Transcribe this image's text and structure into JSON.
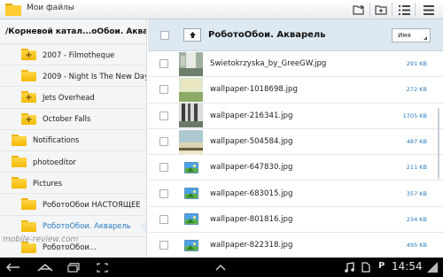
{
  "app": {
    "title": "Мои файлы"
  },
  "sidebar": {
    "header": "/Корневой катал...оОбои. Акварель",
    "items": [
      {
        "label": "2007 - Filmotheque",
        "plus": true,
        "level": 1,
        "active": false
      },
      {
        "label": "2009 - Night Is The New Day",
        "plus": false,
        "level": 1,
        "active": false
      },
      {
        "label": "Jets Overhead",
        "plus": true,
        "level": 1,
        "active": false
      },
      {
        "label": "October Falls",
        "plus": true,
        "level": 1,
        "active": false
      },
      {
        "label": "Notifications",
        "plus": false,
        "level": 0,
        "active": false
      },
      {
        "label": "photoeditor",
        "plus": false,
        "level": 0,
        "active": false
      },
      {
        "label": "Pictures",
        "plus": false,
        "level": 0,
        "active": false
      },
      {
        "label": "РоботоОбои НАСТОЯЩЕЕ",
        "plus": false,
        "level": 1,
        "active": false
      },
      {
        "label": "РоботоОбои. Акварель",
        "plus": false,
        "level": 1,
        "active": true
      },
      {
        "label": "РоботоОбои...",
        "plus": false,
        "level": 1,
        "active": false
      }
    ]
  },
  "main": {
    "path_title": "РоботоОбои. Акварель",
    "sort": {
      "selected": "Имя"
    },
    "files": [
      {
        "name": "Swietokrzyska_by_GreeGW.jpg",
        "size": "291 KB",
        "thumb": "photo1"
      },
      {
        "name": "wallpaper-1018698.jpg",
        "size": "272 KB",
        "thumb": "photo2"
      },
      {
        "name": "wallpaper-216341.jpg",
        "size": "1705 KB",
        "thumb": "photo3"
      },
      {
        "name": "wallpaper-504584.jpg",
        "size": "487 KB",
        "thumb": "photo4"
      },
      {
        "name": "wallpaper-647830.jpg",
        "size": "211 KB",
        "thumb": "icon"
      },
      {
        "name": "wallpaper-683015.jpg",
        "size": "357 KB",
        "thumb": "icon"
      },
      {
        "name": "wallpaper-801816.jpg",
        "size": "234 KB",
        "thumb": "icon"
      },
      {
        "name": "wallpaper-822318.jpg",
        "size": "495 KB",
        "thumb": "icon"
      }
    ]
  },
  "system": {
    "time": "14:54",
    "indicator": "P"
  },
  "watermark": "mobile-review.com",
  "colors": {
    "accent": "#2a7bbf",
    "path_bar": "#dde8f1",
    "folder": "#f2b800",
    "system_bar": "#000000"
  }
}
